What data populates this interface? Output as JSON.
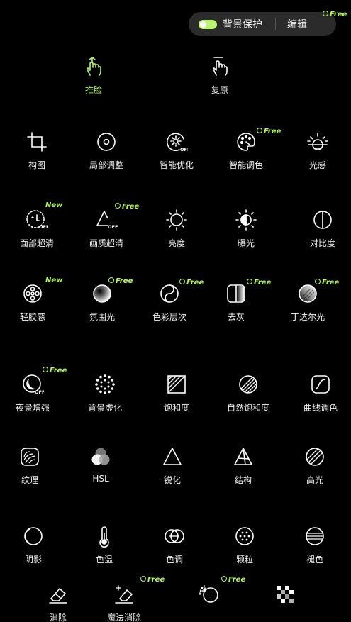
{
  "topbar": {
    "toggle_label": "背景保护",
    "edit_label": "编辑",
    "free_badge": "Free"
  },
  "badges": {
    "free": "Free",
    "new": "New"
  },
  "colors": {
    "accent": "#b6f56d",
    "background": "#000000",
    "pill_bg": "#2b2b2b"
  },
  "tools": [
    {
      "label": "推脸",
      "icon": "push-face-hand-icon"
    },
    {
      "label": "复原",
      "icon": "restore-hand-icon"
    },
    {
      "label": "构图",
      "icon": "crop-icon"
    },
    {
      "label": "局部调整",
      "icon": "local-adjust-icon"
    },
    {
      "label": "智能优化",
      "icon": "smart-optimize-icon"
    },
    {
      "label": "智能调色",
      "icon": "palette-icon"
    },
    {
      "label": "光感",
      "icon": "sun-horizon-icon"
    },
    {
      "label": "面部超清",
      "icon": "face-hd-icon"
    },
    {
      "label": "画质超清",
      "icon": "quality-hd-icon"
    },
    {
      "label": "亮度",
      "icon": "brightness-icon"
    },
    {
      "label": "曝光",
      "icon": "exposure-icon"
    },
    {
      "label": "对比度",
      "icon": "contrast-icon"
    },
    {
      "label": "轻胶感",
      "icon": "film-reel-icon"
    },
    {
      "label": "氛围光",
      "icon": "ambient-light-icon"
    },
    {
      "label": "色彩层次",
      "icon": "color-layers-icon"
    },
    {
      "label": "去灰",
      "icon": "dehaze-icon"
    },
    {
      "label": "丁达尔光",
      "icon": "tyndall-light-icon"
    },
    {
      "label": "夜景增强",
      "icon": "night-enhance-icon"
    },
    {
      "label": "背景虚化",
      "icon": "background-blur-icon"
    },
    {
      "label": "饱和度",
      "icon": "saturation-icon"
    },
    {
      "label": "自然饱和度",
      "icon": "vibrance-icon"
    },
    {
      "label": "曲线调色",
      "icon": "curves-icon"
    },
    {
      "label": "纹理",
      "icon": "texture-icon"
    },
    {
      "label": "HSL",
      "icon": "hsl-icon"
    },
    {
      "label": "锐化",
      "icon": "sharpen-icon"
    },
    {
      "label": "结构",
      "icon": "structure-icon"
    },
    {
      "label": "高光",
      "icon": "highlights-icon"
    },
    {
      "label": "阴影",
      "icon": "shadows-icon"
    },
    {
      "label": "色温",
      "icon": "thermometer-icon"
    },
    {
      "label": "色调",
      "icon": "tint-icon"
    },
    {
      "label": "颗粒",
      "icon": "grain-icon"
    },
    {
      "label": "褪色",
      "icon": "fade-icon"
    },
    {
      "label": "消除",
      "icon": "eraser-icon"
    },
    {
      "label": "魔法消除",
      "icon": "magic-eraser-icon"
    },
    {
      "label": "",
      "icon": "lasso-remove-icon"
    },
    {
      "label": "",
      "icon": "mosaic-icon"
    }
  ]
}
